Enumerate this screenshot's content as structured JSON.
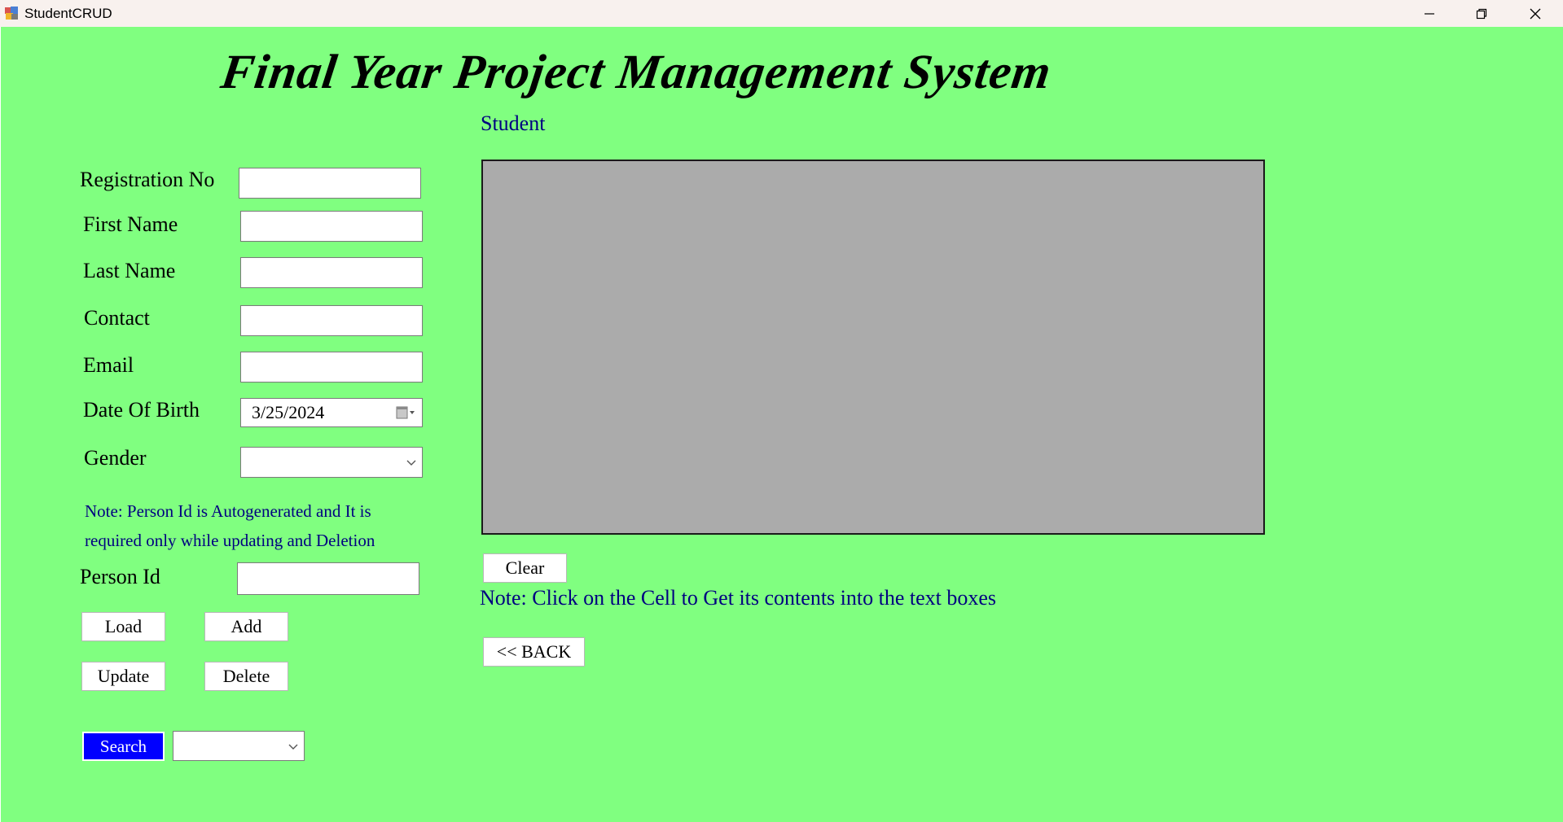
{
  "window": {
    "title": "StudentCRUD",
    "minimize_label": "",
    "restore_label": "",
    "close_label": ""
  },
  "header": {
    "title": "Final Year Project Management System",
    "subtitle": "Student"
  },
  "form": {
    "registration_label": "Registration No",
    "registration_value": "",
    "first_name_label": "First Name",
    "first_name_value": "",
    "last_name_label": "Last Name",
    "last_name_value": "",
    "contact_label": "Contact",
    "contact_value": "",
    "email_label": "Email",
    "email_value": "",
    "dob_label": "Date Of Birth",
    "dob_value": "3/25/2024",
    "gender_label": "Gender",
    "gender_value": "",
    "note_line1": "Note: Person Id is Autogenerated and It is",
    "note_line2": "required only while updating and Deletion",
    "person_id_label": "Person Id",
    "person_id_value": ""
  },
  "buttons": {
    "load": "Load",
    "add": "Add",
    "update": "Update",
    "delete": "Delete",
    "search": "Search",
    "clear": "Clear",
    "back": "<< BACK"
  },
  "search": {
    "selected_value": ""
  },
  "grid": {
    "note": "Note: Click on the Cell to Get its contents into the text boxes"
  },
  "colors": {
    "background": "#80ff80",
    "grid_background": "#ababab",
    "accent_text": "#000080",
    "search_button": "#0000ff"
  },
  "icons": {
    "app": "app-icon",
    "minimize": "minimize-icon",
    "restore": "restore-icon",
    "close": "close-icon",
    "calendar": "calendar-dropdown-icon",
    "dropdown": "chevron-down-icon"
  }
}
